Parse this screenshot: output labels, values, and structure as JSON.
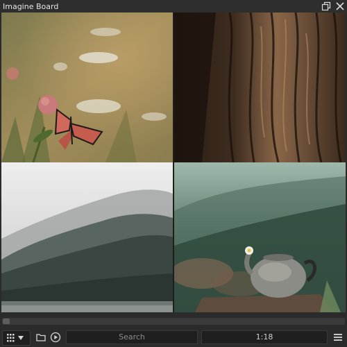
{
  "app": {
    "title": "Imagine Board"
  },
  "icons": {
    "restore": "restore-window-icon",
    "close": "close-icon",
    "grid": "grid-view-icon",
    "dropdown": "chevron-down-icon",
    "folder": "folder-icon",
    "slideshow": "play-circle-icon",
    "menu": "hamburger-menu-icon"
  },
  "thumbnails": [
    {
      "subject": "butterfly on clover flower"
    },
    {
      "subject": "tree bark"
    },
    {
      "subject": "misty forested hills over lake"
    },
    {
      "subject": "old teapot with flower on rock"
    }
  ],
  "scroll": {
    "position": 0
  },
  "toolbar": {
    "search_placeholder": "Search",
    "counter": "1:18"
  },
  "colors": {
    "background": "#2b2b2b",
    "field": "#1f1f1f"
  }
}
